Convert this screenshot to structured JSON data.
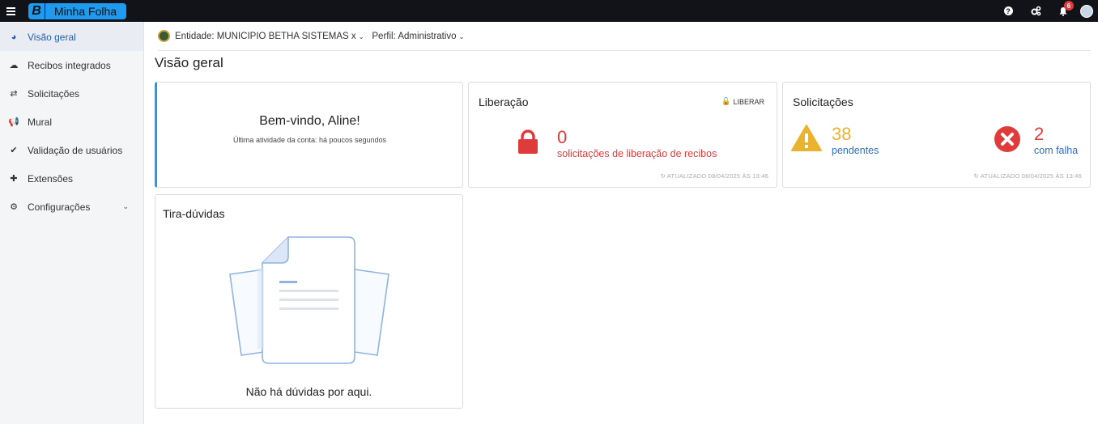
{
  "header": {
    "brand_letter": "B",
    "app_name": "Minha Folha",
    "help_icon": "question-circle-icon",
    "notifications_count": "6"
  },
  "sidebar": {
    "items": [
      {
        "label": "Visão geral",
        "icon": "pie-chart-icon",
        "active": true
      },
      {
        "label": "Recibos integrados",
        "icon": "cloud-download-icon"
      },
      {
        "label": "Solicitações",
        "icon": "exchange-icon"
      },
      {
        "label": "Mural",
        "icon": "bullhorn-icon"
      },
      {
        "label": "Validação de usuários",
        "icon": "check-icon"
      },
      {
        "label": "Extensões",
        "icon": "puzzle-icon"
      },
      {
        "label": "Configurações",
        "icon": "cogs-icon",
        "has_submenu": true
      }
    ]
  },
  "filters": {
    "entity": "Entidade: MUNICIPIO BETHA SISTEMAS x",
    "profile": "Perfil: Administrativo"
  },
  "page_title": "Visão geral",
  "welcome": {
    "heading": "Bem-vindo, Aline!",
    "subtext": "Última atividade da conta: há poucos segundos"
  },
  "liberacao": {
    "title": "Liberação",
    "action": "LIBERAR",
    "count": "0",
    "label": "solicitações de liberação de recibos",
    "updated": "ATUALIZADO 08/04/2025 ÀS 13:46"
  },
  "solicitacoes": {
    "title": "Solicitações",
    "pending_count": "38",
    "pending_label": "pendentes",
    "failed_count": "2",
    "failed_label": "com falha",
    "updated": "ATUALIZADO 08/04/2025 ÀS 13:46"
  },
  "tiraduvidas": {
    "title": "Tira-dúvidas",
    "empty_text": "Não há dúvidas por aqui."
  },
  "colors": {
    "accent": "#1e9bf0",
    "danger": "#e03b3b",
    "warning": "#e9b32f",
    "link": "#2f6fc0"
  }
}
